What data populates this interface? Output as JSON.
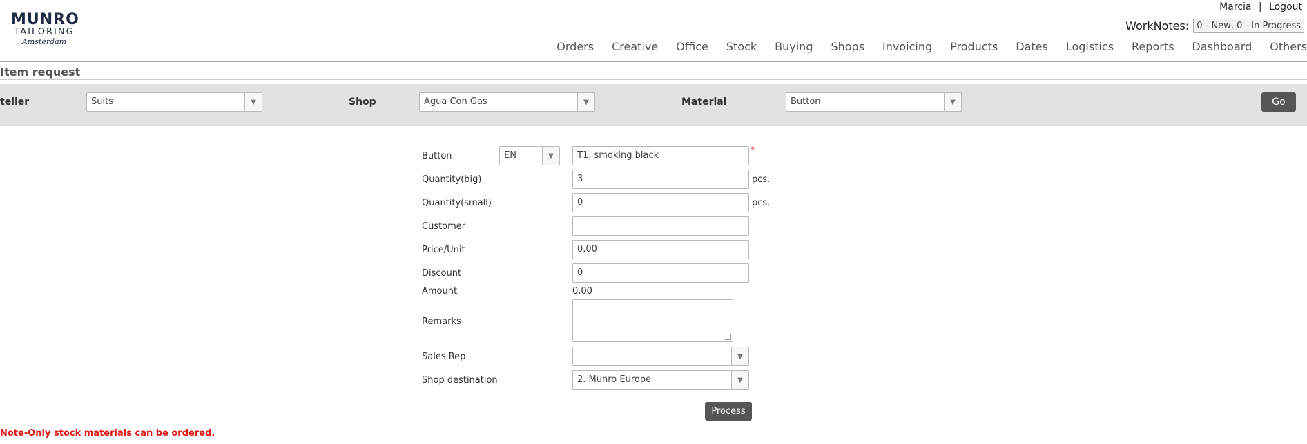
{
  "brand": {
    "line1": "MUNRO",
    "line2": "TAILORING",
    "line3": "Amsterdam"
  },
  "user": {
    "name": "Marcia",
    "separator": "|",
    "logout": "Logout"
  },
  "worknotes": {
    "label": "WorkNotes:",
    "value": "0 - New, 0 - In Progress"
  },
  "nav": [
    "Orders",
    "Creative",
    "Office",
    "Stock",
    "Buying",
    "Shops",
    "Invoicing",
    "Products",
    "Dates",
    "Logistics",
    "Reports",
    "Dashboard",
    "Others"
  ],
  "page": {
    "title": "Item request"
  },
  "filters": {
    "atelier_label": "telier",
    "atelier_value": "Suits",
    "shop_label": "Shop",
    "shop_value": "Agua Con Gas",
    "material_label": "Material",
    "material_value": "Button",
    "go_label": "Go"
  },
  "form": {
    "button_label": "Button",
    "language_value": "EN",
    "button_value": "T1. smoking black",
    "required_mark": "*",
    "qty_big_label": "Quantity(big)",
    "qty_big_value": "3",
    "qty_small_label": "Quantity(small)",
    "qty_small_value": "0",
    "unit": "pcs.",
    "customer_label": "Customer",
    "customer_value": "",
    "price_label": "Price/Unit",
    "price_value": "0,00",
    "discount_label": "Discount",
    "discount_value": "0",
    "amount_label": "Amount",
    "amount_value": "0,00",
    "remarks_label": "Remarks",
    "sales_rep_label": "Sales Rep",
    "sales_rep_value": "",
    "shop_dest_label": "Shop destination",
    "shop_dest_value": "2. Munro Europe",
    "process_label": "Process"
  },
  "note": "Note-Only stock materials can be ordered."
}
